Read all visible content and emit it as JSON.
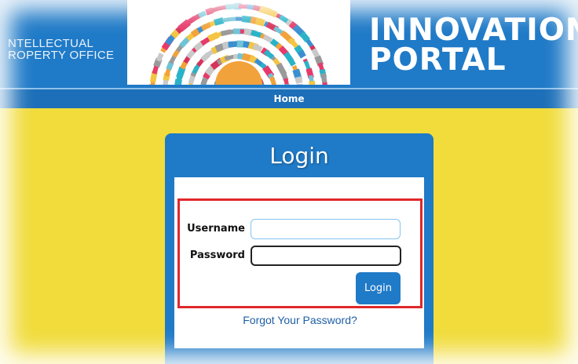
{
  "header": {
    "org_line1": "NTELLECTUAL",
    "org_line2": "ROPERTY OFFICE",
    "title_line1": "INNOVATION",
    "title_line2": "PORTAL"
  },
  "nav": {
    "home_label": "Home"
  },
  "login": {
    "title": "Login",
    "username_label": "Username",
    "username_value": "",
    "password_label": "Password",
    "password_value": "",
    "button_label": "Login",
    "forgot_label": "Forgot Your Password?"
  },
  "colors": {
    "header_blue": "#1f7ac7",
    "navbar_blue": "#1c6fb8",
    "background_yellow": "#f1dc3c",
    "highlight_red": "#e0282a"
  },
  "icons": [
    "innovation-burst-graphic"
  ]
}
